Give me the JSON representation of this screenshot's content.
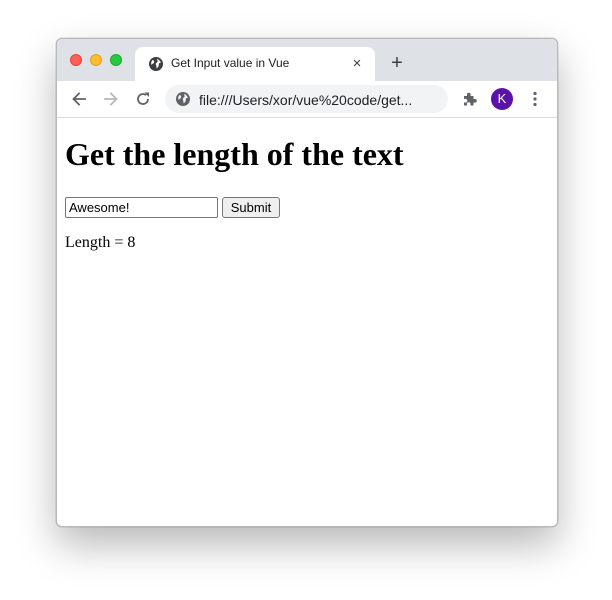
{
  "browser": {
    "tab": {
      "title": "Get Input value in Vue",
      "close_icon": "×",
      "favicon_icon": "globe-icon"
    },
    "new_tab_icon": "+",
    "address_bar": {
      "url": "file:///Users/xor/vue%20code/get...",
      "site_icon": "globe-icon"
    },
    "profile": {
      "initial": "K",
      "color": "#5b12a8"
    },
    "icons": {
      "back": "arrow-left-icon",
      "forward": "arrow-right-icon",
      "reload": "reload-icon",
      "extensions": "puzzle-icon",
      "menu": "kebab-menu-icon"
    }
  },
  "page": {
    "heading": "Get the length of the text",
    "input": {
      "value": "Awesome!"
    },
    "submit_label": "Submit",
    "length_text": "Length = 8"
  },
  "colors": {
    "tabstrip_bg": "#dee1e6",
    "omnibox_bg": "#f1f3f4",
    "traffic_close": "#fe5f57",
    "traffic_min": "#febc2e",
    "traffic_max": "#28c840"
  }
}
